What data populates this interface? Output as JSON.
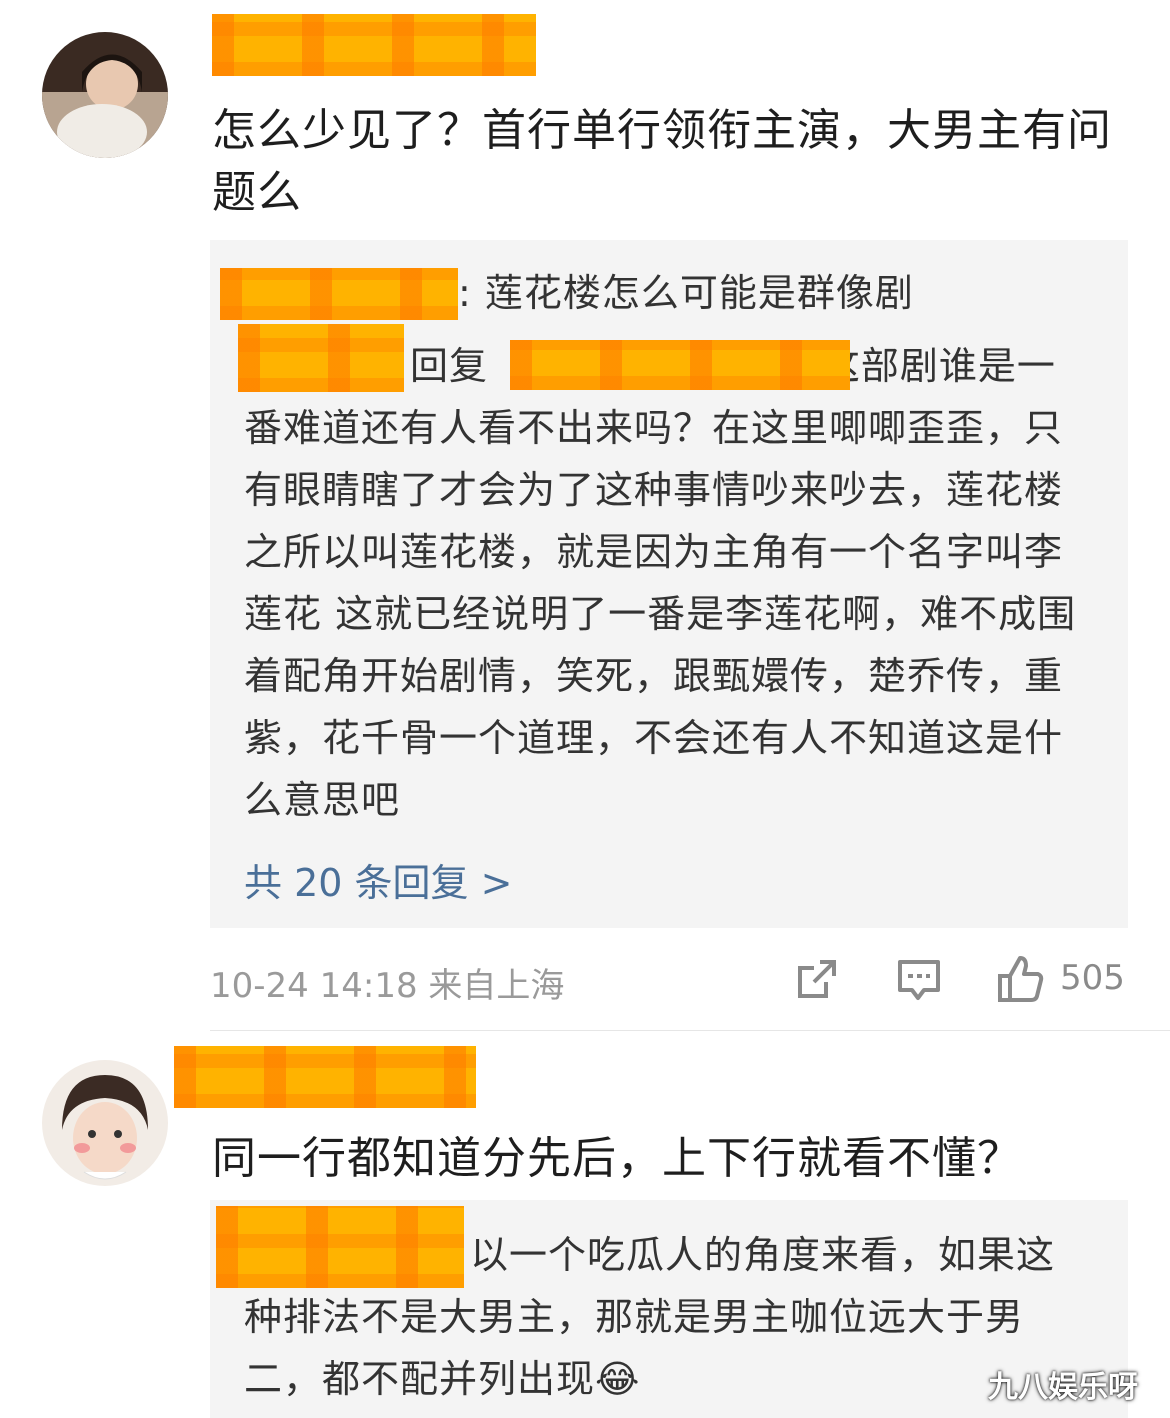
{
  "comments": [
    {
      "text": "怎么少见了？首行单行领衔主演，大男主有问题么",
      "replies": {
        "reply1": ": 莲花楼怎么可能是群像剧",
        "reply2_action": "回复",
        "reply2_text": ":这部剧谁是一番难道还有人看不出来吗？在这里唧唧歪歪，只有眼睛瞎了才会为了这种事情吵来吵去，莲花楼之所以叫莲花楼，就是因为主角有一个名字叫李莲花 这就已经说明了一番是李莲花啊，难不成围着配角开始剧情，笑死，跟甄嬛传，楚乔传，重紫，花千骨一个道理，不会还有人不知道这是什么意思吧",
        "more_link": "共 20 条回复 >"
      },
      "time_location": "10-24 14:18 来自上海",
      "like_count": "505"
    },
    {
      "text": "同一行都知道分先后，上下行就看不懂？",
      "reply_text": "以一个吃瓜人的角度来看，如果这种排法不是大男主，那就是男主咖位远大于男二，都不配并列出现",
      "reply_emoji": "😂"
    }
  ],
  "watermark": "九八娱乐呀",
  "colors": {
    "redaction": "#ffb300",
    "link": "#4a6f98",
    "meta": "#9a9a9a"
  }
}
